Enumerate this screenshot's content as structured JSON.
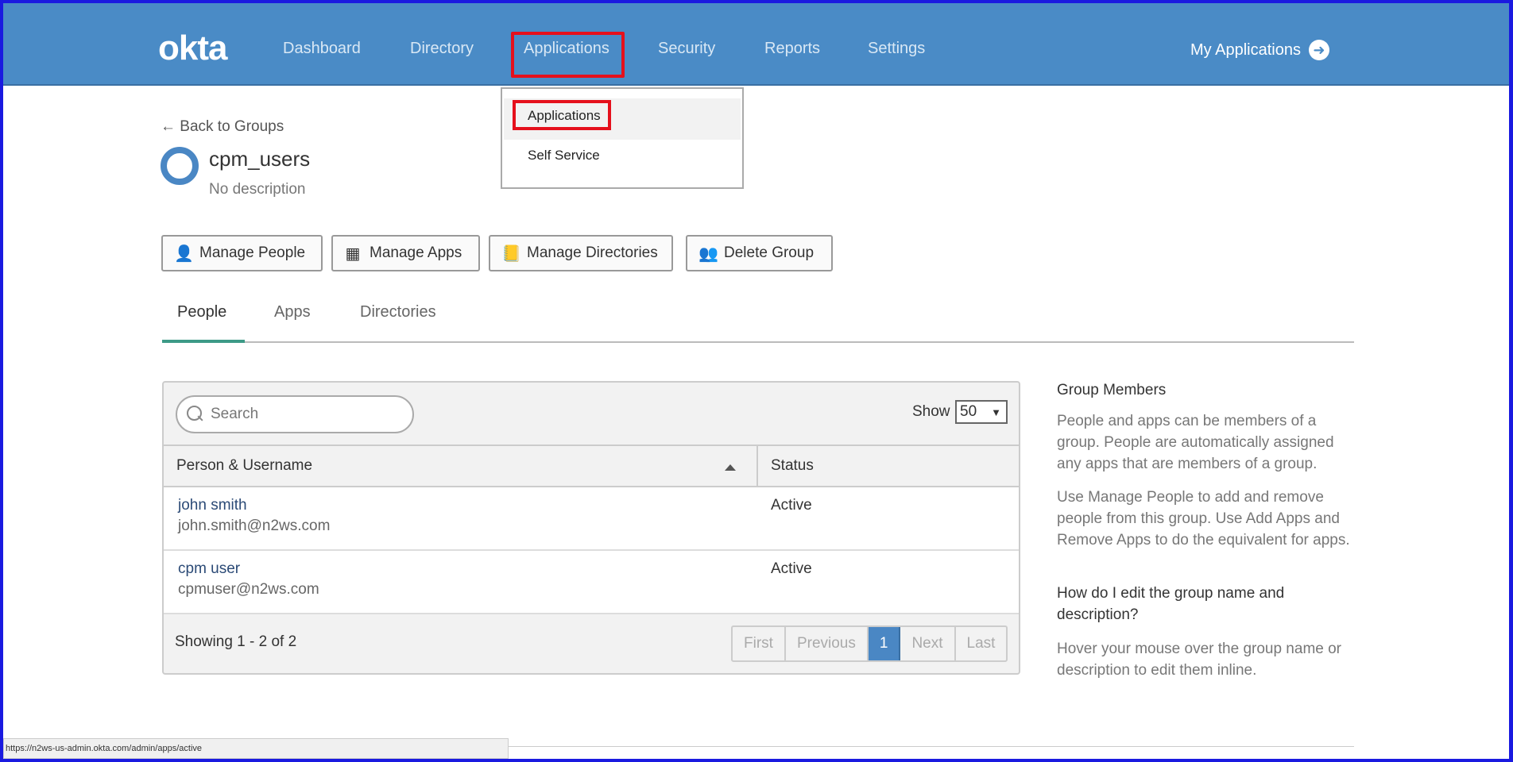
{
  "header": {
    "logo": "okta",
    "nav": [
      "Dashboard",
      "Directory",
      "Applications",
      "Security",
      "Reports",
      "Settings"
    ],
    "my_apps": "My Applications"
  },
  "dropdown": {
    "items": [
      "Applications",
      "Self Service"
    ]
  },
  "group": {
    "back_link": "← Back to Groups",
    "name": "cpm_users",
    "description": "No description"
  },
  "actions": {
    "manage_people": "Manage People",
    "manage_apps": "Manage Apps",
    "manage_directories": "Manage Directories",
    "delete_group": "Delete Group"
  },
  "tabs": [
    "People",
    "Apps",
    "Directories"
  ],
  "table": {
    "search_placeholder": "Search",
    "show_label": "Show",
    "show_value": "50",
    "columns": [
      "Person & Username",
      "Status"
    ],
    "rows": [
      {
        "name": "john smith",
        "username": "john.smith@n2ws.com",
        "status": "Active"
      },
      {
        "name": "cpm user",
        "username": "cpmuser@n2ws.com",
        "status": "Active"
      }
    ],
    "showing": "Showing 1 - 2 of 2",
    "pager": [
      "First",
      "Previous",
      "1",
      "Next",
      "Last"
    ]
  },
  "help": {
    "title": "Group Members",
    "p1": "People and apps can be members of a group. People are automatically assigned any apps that are members of a group.",
    "p2": "Use Manage People to add and remove people from this group. Use Add Apps and Remove Apps to do the equivalent for apps.",
    "question": "How do I edit the group name and description?",
    "answer": "Hover your mouse over the group name or description to edit them inline."
  },
  "statusbar": {
    "url": "https://n2ws-us-admin.okta.com/admin/apps/active"
  },
  "colors": {
    "header_bg": "#4a8bc6",
    "highlight_red": "#e5101c",
    "tab_accent": "#3d9a87",
    "pager_active": "#4a87c4"
  }
}
